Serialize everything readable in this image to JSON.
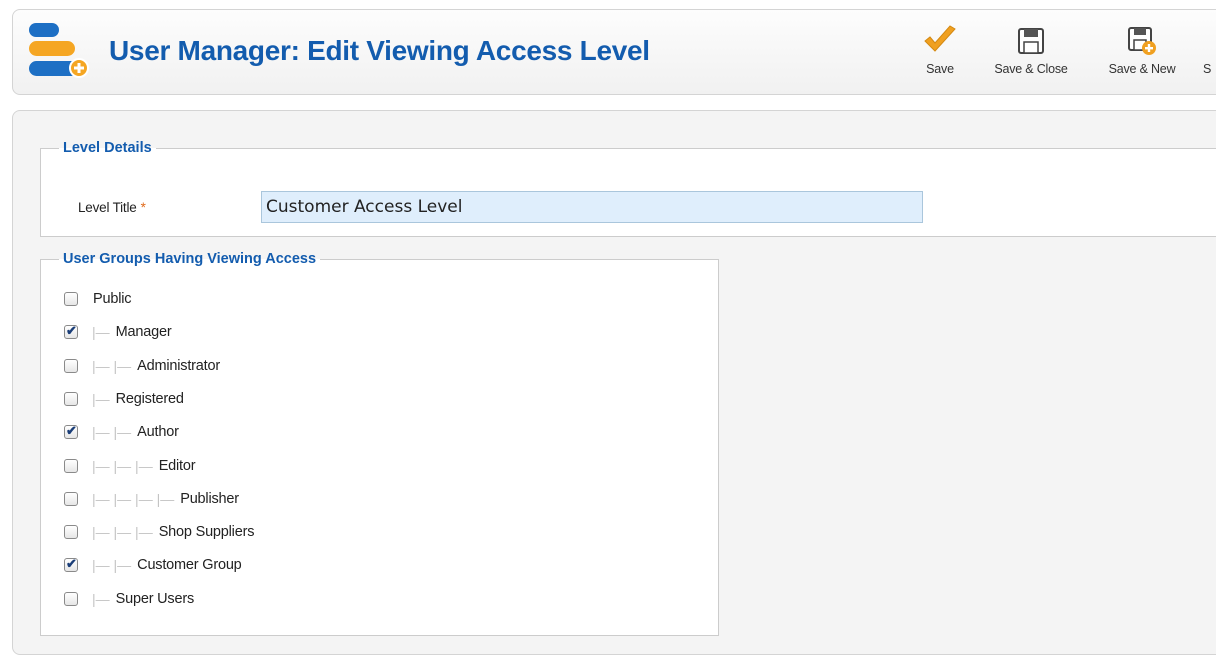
{
  "header": {
    "title": "User Manager: Edit Viewing Access Level",
    "toolbar": [
      {
        "label": "Save",
        "icon": "checkmark-icon"
      },
      {
        "label": "Save & Close",
        "icon": "floppy-disk-icon"
      },
      {
        "label": "Save & New",
        "icon": "floppy-disk-plus-icon"
      },
      {
        "label": "S",
        "icon": "floppy-disk-copy-icon"
      }
    ]
  },
  "level_details": {
    "legend": "Level Details",
    "title_label": "Level Title",
    "required_mark": "*",
    "title_value": "Customer Access Level"
  },
  "user_groups": {
    "legend": "User Groups Having Viewing Access",
    "groups": [
      {
        "label": "Public",
        "depth": 0,
        "checked": false
      },
      {
        "label": "Manager",
        "depth": 1,
        "checked": true
      },
      {
        "label": "Administrator",
        "depth": 2,
        "checked": false
      },
      {
        "label": "Registered",
        "depth": 1,
        "checked": false
      },
      {
        "label": "Author",
        "depth": 2,
        "checked": true
      },
      {
        "label": "Editor",
        "depth": 3,
        "checked": false
      },
      {
        "label": "Publisher",
        "depth": 4,
        "checked": false
      },
      {
        "label": "Shop Suppliers",
        "depth": 3,
        "checked": false
      },
      {
        "label": "Customer Group",
        "depth": 2,
        "checked": true
      },
      {
        "label": "Super Users",
        "depth": 1,
        "checked": false
      }
    ]
  },
  "colors": {
    "title_blue": "#135cae",
    "save_orange": "#f0a020",
    "input_bg": "#dfeefc"
  }
}
